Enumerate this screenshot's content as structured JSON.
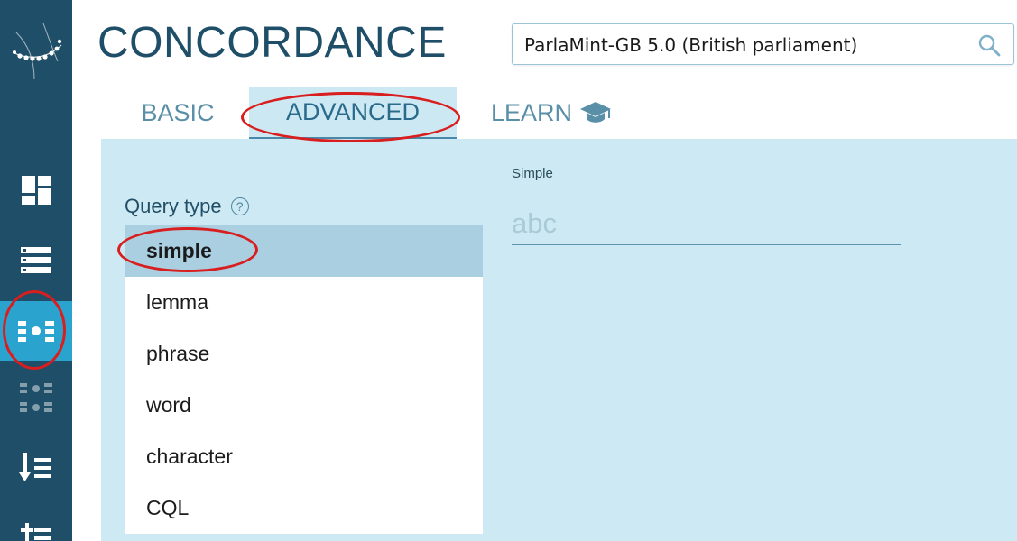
{
  "header": {
    "app_title": "CONCORDANCE",
    "corpus": "ParlaMint-GB 5.0 (British parliament)"
  },
  "sidebar": {
    "items": [
      {
        "icon": "dashboard-icon",
        "state": "normal"
      },
      {
        "icon": "list-icon",
        "state": "normal"
      },
      {
        "icon": "concordance-icon",
        "state": "active"
      },
      {
        "icon": "parallel-concordance-icon",
        "state": "disabled"
      },
      {
        "icon": "word-list-icon",
        "state": "normal"
      },
      {
        "icon": "word-sketch-icon",
        "state": "normal"
      }
    ]
  },
  "tabs": [
    {
      "label": "BASIC",
      "active": false
    },
    {
      "label": "ADVANCED",
      "active": true
    },
    {
      "label": "LEARN",
      "active": false,
      "icon": "graduation-cap-icon"
    }
  ],
  "query_type": {
    "label": "Query type",
    "help_glyph": "?",
    "options": [
      "simple",
      "lemma",
      "phrase",
      "word",
      "character",
      "CQL"
    ],
    "selected": "simple"
  },
  "simple_field": {
    "label": "Simple",
    "placeholder": "abc",
    "value": ""
  },
  "colors": {
    "rail": "#1f4e68",
    "rail_active": "#2aa3cf",
    "panel": "#cde9f3",
    "title": "#1f4e68",
    "annotation": "#d81e1e"
  }
}
